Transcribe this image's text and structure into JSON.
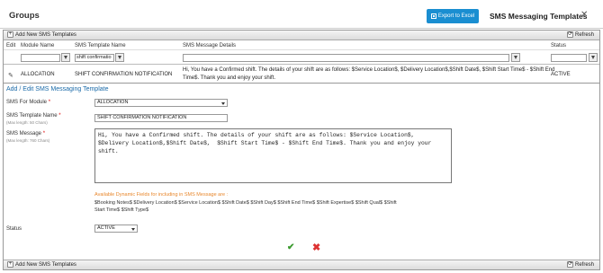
{
  "header": {
    "page_title": "Groups",
    "export_label": "Export to Excel",
    "dialog_title": "SMS Messaging Templates",
    "close_glyph": "✕"
  },
  "toolbar": {
    "add_label": "Add New SMS Templates",
    "refresh_label": "Refresh"
  },
  "columns": [
    "Edit",
    "Module Name",
    "SMS Template Name",
    "SMS Message Details",
    "Status"
  ],
  "filters": {
    "module": "",
    "template": "shift confirmatio",
    "details": "",
    "status": ""
  },
  "row": {
    "module": "ALLOCATION",
    "template": "SHIFT CONFIRMATION NOTIFICATION",
    "details_line1": "Hi, You have a Confirmed shift. The details of your shift are as follows: $Service Location$, $Delivery Location$,$Shift Date$, $Shift Start Time$ - $Shift End",
    "details_line2": "Time$. Thank you and enjoy your shift.",
    "status": "ACTIVE"
  },
  "form": {
    "title": "Add / Edit SMS Messaging Template",
    "module_label": "SMS For Module",
    "module_value": "ALLOCATION",
    "template_label": "SMS Template Name",
    "template_hint": "(Max length: 50 Chars)",
    "template_value": "SHIFT CONFIRMATION NOTIFICATION",
    "message_label": "SMS Message",
    "message_hint": "(Max length: 760 Chars)",
    "message_value": "Hi, You have a Confirmed shift. The details of your shift are as follows: $Service Location$, $Delivery Location$,$Shift Date$,  $Shift Start Time$ - $Shift End Time$. Thank you and enjoy your shift.",
    "required_mark": "*",
    "fields_title": "Available Dynamic Fields for including in SMS Message are :",
    "fields_list": "$Booking Notes$ $Delivery Location$ $Service Location$ $Shift Date$ $Shift Day$ $Shift End Time$ $Shift Expertise$ $Shift Qual$ $Shift Start Time$ $Shift Type$",
    "status_label": "Status",
    "status_value": "ACTIVE",
    "ok_glyph": "✔",
    "cancel_glyph": "✖"
  },
  "icons": {
    "plus": "+",
    "refresh": "⟳",
    "pencil": "✎"
  },
  "colors": {
    "accent": "#1a8ed1",
    "link_blue": "#1a6aa8",
    "fields_orange": "#e8872c",
    "ok_green": "#3a9a2e",
    "cancel_red": "#d33333"
  }
}
